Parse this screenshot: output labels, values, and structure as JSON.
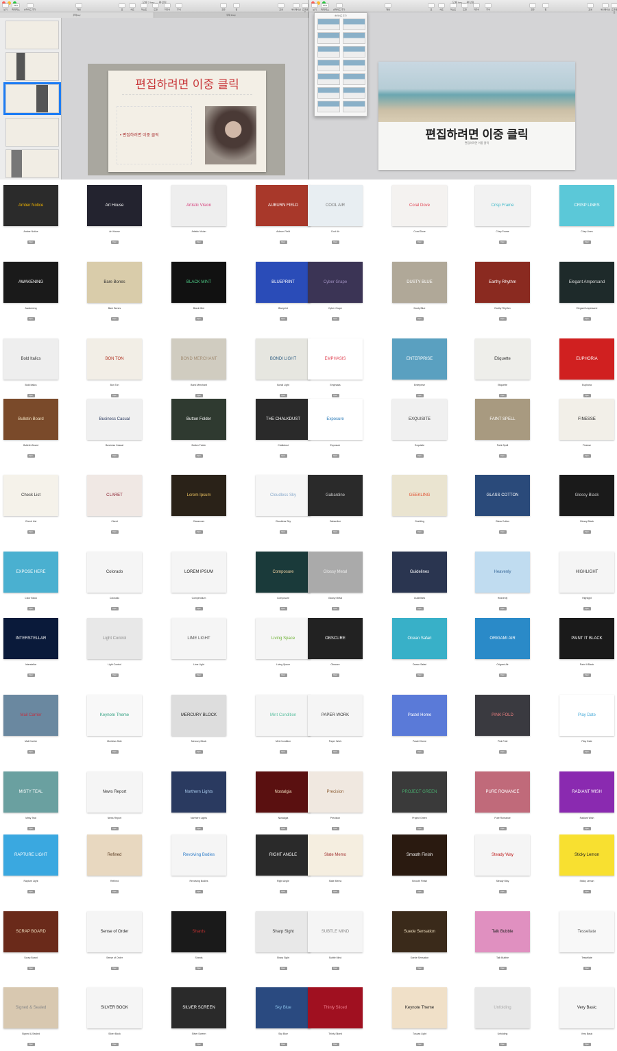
{
  "left_window": {
    "title": "무제 2.key — 편집됨",
    "tabs": [
      "무제.key",
      "무제 2.key"
    ],
    "toolbar": [
      "보기",
      "확대/축소",
      "슬라이드 추가",
      "재생",
      "표",
      "차트",
      "텍스트",
      "도형",
      "미디어",
      "주석",
      "공유",
      "팁",
      "포맷",
      "애니메이션",
      "도큐멘트"
    ],
    "zoom_value": "63%",
    "slide_title": "편집하려면 이중 클릭",
    "slide_body": "• 편집하려면 이중 클릭"
  },
  "right_window": {
    "title": "무제.key — 편집됨",
    "toolbar": [
      "보기",
      "확대/축소",
      "슬라이드 추가",
      "재생",
      "표",
      "차트",
      "텍스트",
      "도형",
      "미디어",
      "주석",
      "공유",
      "팁",
      "포맷",
      "애니메이션",
      "도큐멘트"
    ],
    "zoom_value": "50%",
    "popover_title": "슬라이드 추가",
    "slide_title": "편집하려면 이중 클릭",
    "slide_subtitle": "편집하려면 이중 클릭"
  },
  "open_label": "Open",
  "themes": [
    {
      "name": "Amber Notice",
      "thumb": "Amber Notice",
      "bg": "#2b2b2b",
      "fg": "#f0b400"
    },
    {
      "name": "Art House",
      "thumb": "Art House",
      "bg": "#23232f",
      "fg": "#ffffff"
    },
    {
      "name": "Artistic Vision",
      "thumb": "Artistic Vision",
      "bg": "#eeeeee",
      "fg": "#d63a78"
    },
    {
      "name": "Auburn Field",
      "thumb": "AUBURN FIELD",
      "bg": "#a8382a",
      "fg": "#ffffff"
    },
    {
      "name": "Cool Air",
      "thumb": "COOL AIR",
      "bg": "#e8eef2",
      "fg": "#777777"
    },
    {
      "name": "Coral Dove",
      "thumb": "Coral Dove",
      "bg": "#f4f2f0",
      "fg": "#e04050"
    },
    {
      "name": "Crisp Frame",
      "thumb": "Crisp Frame",
      "bg": "#f2f2f2",
      "fg": "#3bb8c8"
    },
    {
      "name": "Crisp Lines",
      "thumb": "CRISP LINES",
      "bg": "#5bc8d8",
      "fg": "#ffffff"
    },
    {
      "name": "Awakening",
      "thumb": "AWAKENING",
      "bg": "#1a1a1a",
      "fg": "#ffffff"
    },
    {
      "name": "Bare Bones",
      "thumb": "Bare Bones",
      "bg": "#d9ccaa",
      "fg": "#333333"
    },
    {
      "name": "Black Mint",
      "thumb": "BLACK MINT",
      "bg": "#111111",
      "fg": "#4fd08a"
    },
    {
      "name": "Blueprint",
      "thumb": "BLUEPRINT",
      "bg": "#2a4cb8",
      "fg": "#ffffff"
    },
    {
      "name": "Cyber Grape",
      "thumb": "Cyber Grape",
      "bg": "#3b3455",
      "fg": "#a090c0"
    },
    {
      "name": "Dusty Blue",
      "thumb": "DUSTY BLUE",
      "bg": "#b0a898",
      "fg": "#ffffff"
    },
    {
      "name": "Earthy Rhythm",
      "thumb": "Earthy Rhythm",
      "bg": "#8a2a20",
      "fg": "#ffffff"
    },
    {
      "name": "Elegant Ampersand",
      "thumb": "Elegant Ampersand",
      "bg": "#1e2a2a",
      "fg": "#dddddd"
    },
    {
      "name": "Bold Italics",
      "thumb": "Bold Italics",
      "bg": "#eeeeee",
      "fg": "#333333"
    },
    {
      "name": "Bon Ton",
      "thumb": "BON TON",
      "bg": "#f2eee6",
      "fg": "#b03020"
    },
    {
      "name": "Bond Merchant",
      "thumb": "BOND MERCHANT",
      "bg": "#d0ccc0",
      "fg": "#a08a70"
    },
    {
      "name": "Bondi Light",
      "thumb": "BONDI LIGHT",
      "bg": "#e6e6e0",
      "fg": "#2a5a80"
    },
    {
      "name": "Emphasis",
      "thumb": "EMPHASIS",
      "bg": "#ffffff",
      "fg": "#e04050"
    },
    {
      "name": "Enterprise",
      "thumb": "ENTERPRISE",
      "bg": "#5aa0c0",
      "fg": "#ffffff"
    },
    {
      "name": "Etiquette",
      "thumb": "Etiquette",
      "bg": "#eeeeea",
      "fg": "#333333"
    },
    {
      "name": "Euphoria",
      "thumb": "EUPHORIA",
      "bg": "#d02020",
      "fg": "#ffffff"
    },
    {
      "name": "Bulletin Board",
      "thumb": "Bulletin Board",
      "bg": "#7a4a2a",
      "fg": "#f0e0c0"
    },
    {
      "name": "Business Casual",
      "thumb": "Business Casual",
      "bg": "#f0f0f0",
      "fg": "#2a3a60"
    },
    {
      "name": "Button Folder",
      "thumb": "Button Folder",
      "bg": "#2f3a30",
      "fg": "#ffffff"
    },
    {
      "name": "Chalkdust",
      "thumb": "THE CHALKDUST",
      "bg": "#2a2a2a",
      "fg": "#ffffff"
    },
    {
      "name": "Exposure",
      "thumb": "Exposure",
      "bg": "#ffffff",
      "fg": "#2a7ab8"
    },
    {
      "name": "Exquisite",
      "thumb": "EXQUISITE",
      "bg": "#f0f0f0",
      "fg": "#333333"
    },
    {
      "name": "Faint Spell",
      "thumb": "FAINT SPELL",
      "bg": "#a89a80",
      "fg": "#ffffff"
    },
    {
      "name": "Finesse",
      "thumb": "FINESSE",
      "bg": "#f2efe8",
      "fg": "#222222"
    },
    {
      "name": "Check List",
      "thumb": "Check List",
      "bg": "#f5f2ea",
      "fg": "#333333"
    },
    {
      "name": "Claret",
      "thumb": "CLARET",
      "bg": "#f0e8e4",
      "fg": "#8a2030"
    },
    {
      "name": "Classroom",
      "thumb": "Lorem Ipsum",
      "bg": "#2a2218",
      "fg": "#e8c060"
    },
    {
      "name": "Cloudless Sky",
      "thumb": "Cloudless Sky",
      "bg": "#f6f6f6",
      "fg": "#88aacc"
    },
    {
      "name": "Gabardine",
      "thumb": "Gabardine",
      "bg": "#2a2a2a",
      "fg": "#cccccc"
    },
    {
      "name": "Geekling",
      "thumb": "GEEKLING",
      "bg": "#eae4d0",
      "fg": "#e05030"
    },
    {
      "name": "Glass Cotton",
      "thumb": "GLASS COTTON",
      "bg": "#2a4a7a",
      "fg": "#ffffff"
    },
    {
      "name": "Glossy Black",
      "thumb": "Glossy Black",
      "bg": "#1a1a1a",
      "fg": "#cccccc"
    },
    {
      "name": "Color Block",
      "thumb": "EXPOSE HERE",
      "bg": "#4ab0d0",
      "fg": "#ffffff"
    },
    {
      "name": "Colorado",
      "thumb": "Colorado",
      "bg": "#f5f5f5",
      "fg": "#333333"
    },
    {
      "name": "Compendium",
      "thumb": "LOREM IPSUM",
      "bg": "#f5f5f5",
      "fg": "#222222"
    },
    {
      "name": "Composure",
      "thumb": "Composure",
      "bg": "#1a3a3a",
      "fg": "#f0d0a0"
    },
    {
      "name": "Glossy Metal",
      "thumb": "Glossy Metal",
      "bg": "#aaaaaa",
      "fg": "#eeeeee"
    },
    {
      "name": "Guidelines",
      "thumb": "Guidelines",
      "bg": "#2a3550",
      "fg": "#ffffff"
    },
    {
      "name": "Heavenly",
      "thumb": "Heavenly",
      "bg": "#c0dcf0",
      "fg": "#3a6a9a"
    },
    {
      "name": "Highlight",
      "thumb": "HIGHLIGHT",
      "bg": "#f5f5f5",
      "fg": "#333333"
    },
    {
      "name": "Interstellar",
      "thumb": "INTERSTELLAR",
      "bg": "#0a1a3a",
      "fg": "#ffffff"
    },
    {
      "name": "Light Control",
      "thumb": "Light Control",
      "bg": "#e8e8e8",
      "fg": "#888888"
    },
    {
      "name": "Lime Light",
      "thumb": "LIME LIGHT",
      "bg": "#f5f5f5",
      "fg": "#555555"
    },
    {
      "name": "Living Space",
      "thumb": "Living Space",
      "bg": "#f5f5f5",
      "fg": "#6ab030"
    },
    {
      "name": "Obscure",
      "thumb": "OBSCURE",
      "bg": "#222222",
      "fg": "#ffffff"
    },
    {
      "name": "Ocean Safari",
      "thumb": "Ocean Safari",
      "bg": "#38b0c8",
      "fg": "#ffffff"
    },
    {
      "name": "Origami Air",
      "thumb": "ORIGAMI AIR",
      "bg": "#2a8ac8",
      "fg": "#ffffff"
    },
    {
      "name": "Paint It Black",
      "thumb": "PAINT IT BLACK",
      "bg": "#1a1a1a",
      "fg": "#ffffff"
    },
    {
      "name": "Mail Carrier",
      "thumb": "Mail Carrier",
      "bg": "#6a88a0",
      "fg": "#c03040"
    },
    {
      "name": "Meridian Side",
      "thumb": "Keynote Theme",
      "bg": "#f8f8f8",
      "fg": "#30a080"
    },
    {
      "name": "Mercury Block",
      "thumb": "MERCURY BLOCK",
      "bg": "#dddddd",
      "fg": "#222222"
    },
    {
      "name": "Mint Condition",
      "thumb": "Mint Condition",
      "bg": "#f5f5f5",
      "fg": "#5ac0a0"
    },
    {
      "name": "Paper Work",
      "thumb": "PAPER WORK",
      "bg": "#f5f5f5",
      "fg": "#333333"
    },
    {
      "name": "Pastel Home",
      "thumb": "Pastel Home",
      "bg": "#5a7ad8",
      "fg": "#ffffff"
    },
    {
      "name": "Pink Fold",
      "thumb": "PINK FOLD",
      "bg": "#3a3a40",
      "fg": "#f08080"
    },
    {
      "name": "Play Date",
      "thumb": "Play Date",
      "bg": "#ffffff",
      "fg": "#40a8d8"
    },
    {
      "name": "Misty Teal",
      "thumb": "MISTY TEAL",
      "bg": "#6aa0a0",
      "fg": "#ffffff"
    },
    {
      "name": "News Report",
      "thumb": "News Report",
      "bg": "#f5f5f5",
      "fg": "#333333"
    },
    {
      "name": "Northern Lights",
      "thumb": "Northern Lights",
      "bg": "#2a3a60",
      "fg": "#aaccee"
    },
    {
      "name": "Nostalgia",
      "thumb": "Nostalgia",
      "bg": "#5a1010",
      "fg": "#f0e0c0"
    },
    {
      "name": "Precision",
      "thumb": "Precision",
      "bg": "#f0e8e0",
      "fg": "#8a5a30"
    },
    {
      "name": "Project Green",
      "thumb": "PROJECT GREEN",
      "bg": "#3a3a3a",
      "fg": "#4ab070"
    },
    {
      "name": "Pure Romance",
      "thumb": "PURE ROMANCE",
      "bg": "#c06a7a",
      "fg": "#ffffff"
    },
    {
      "name": "Radiant Wish",
      "thumb": "RADIANT WISH",
      "bg": "#8a2ab0",
      "fg": "#ffffff"
    },
    {
      "name": "Rapture Light",
      "thumb": "RAPTURE LIGHT",
      "bg": "#3aa8e0",
      "fg": "#ffffff"
    },
    {
      "name": "Refined",
      "thumb": "Refined",
      "bg": "#e8d8c0",
      "fg": "#5a3a20"
    },
    {
      "name": "Revolving Bodies",
      "thumb": "Revolving Bodies",
      "bg": "#f5f5f5",
      "fg": "#2a7ac8"
    },
    {
      "name": "Right Angle",
      "thumb": "RIGHT ANGLE",
      "bg": "#2a2a2a",
      "fg": "#ffffff"
    },
    {
      "name": "Slate Memo",
      "thumb": "Slate Memo",
      "bg": "#f5eee0",
      "fg": "#a03030"
    },
    {
      "name": "Smooth Finish",
      "thumb": "Smooth Finish",
      "bg": "#2a1a10",
      "fg": "#ffffff"
    },
    {
      "name": "Steady Way",
      "thumb": "Steady Way",
      "bg": "#f5f5f5",
      "fg": "#c02020"
    },
    {
      "name": "Sticky Lemon",
      "thumb": "Sticky Lemon",
      "bg": "#f8e030",
      "fg": "#222222"
    },
    {
      "name": "Scrap Board",
      "thumb": "SCRAP BOARD",
      "bg": "#6a2a1a",
      "fg": "#f0e0c0"
    },
    {
      "name": "Sense of Order",
      "thumb": "Sense of Order",
      "bg": "#f5f5f5",
      "fg": "#222222"
    },
    {
      "name": "Shards",
      "thumb": "Shards",
      "bg": "#1a1a1a",
      "fg": "#c03030"
    },
    {
      "name": "Sharp Sight",
      "thumb": "Sharp Sight",
      "bg": "#e8e8e8",
      "fg": "#333333"
    },
    {
      "name": "Subtle Mind",
      "thumb": "SUBTLE MIND",
      "bg": "#f5f5f5",
      "fg": "#888888"
    },
    {
      "name": "Suede Sensation",
      "thumb": "Suede Sensation",
      "bg": "#3a2a1a",
      "fg": "#f0e0c0"
    },
    {
      "name": "Talk Bubble",
      "thumb": "Talk Bubble",
      "bg": "#e090c0",
      "fg": "#222222"
    },
    {
      "name": "Tessellate",
      "thumb": "Tessellate",
      "bg": "#f8f8f8",
      "fg": "#555555"
    },
    {
      "name": "Signed & Sealed",
      "thumb": "Signed & Sealed",
      "bg": "#d8c8b0",
      "fg": "#888888"
    },
    {
      "name": "Silver Book",
      "thumb": "SILVER BOOK",
      "bg": "#f5f5f5",
      "fg": "#222222"
    },
    {
      "name": "Silver Screen",
      "thumb": "SILVER SCREEN",
      "bg": "#2a2a2a",
      "fg": "#ffffff"
    },
    {
      "name": "Sky Blue",
      "thumb": "Sky Blue",
      "bg": "#2a4a80",
      "fg": "#8ac0e8"
    },
    {
      "name": "Thinly Sliced",
      "thumb": "Thinly Sliced",
      "bg": "#a01020",
      "fg": "#f08090"
    },
    {
      "name": "Tuscan Light",
      "thumb": "Keynote Theme",
      "bg": "#f0e0c8",
      "fg": "#222222"
    },
    {
      "name": "Unfolding",
      "thumb": "Unfolding",
      "bg": "#e8e8e8",
      "fg": "#aaaaaa"
    },
    {
      "name": "Very Basic",
      "thumb": "Very Basic",
      "bg": "#f5f5f5",
      "fg": "#222222"
    }
  ]
}
